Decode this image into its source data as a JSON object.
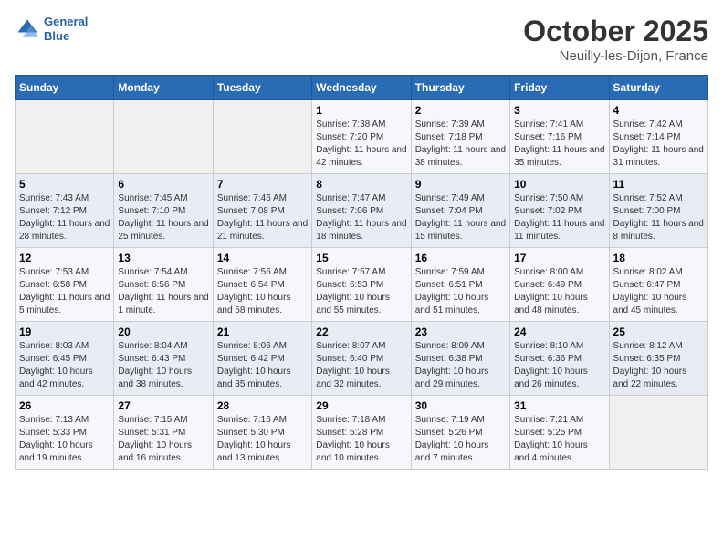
{
  "header": {
    "logo_line1": "General",
    "logo_line2": "Blue",
    "title": "October 2025",
    "subtitle": "Neuilly-les-Dijon, France"
  },
  "weekdays": [
    "Sunday",
    "Monday",
    "Tuesday",
    "Wednesday",
    "Thursday",
    "Friday",
    "Saturday"
  ],
  "weeks": [
    [
      {
        "day": "",
        "info": ""
      },
      {
        "day": "",
        "info": ""
      },
      {
        "day": "",
        "info": ""
      },
      {
        "day": "1",
        "info": "Sunrise: 7:38 AM\nSunset: 7:20 PM\nDaylight: 11 hours and 42 minutes."
      },
      {
        "day": "2",
        "info": "Sunrise: 7:39 AM\nSunset: 7:18 PM\nDaylight: 11 hours and 38 minutes."
      },
      {
        "day": "3",
        "info": "Sunrise: 7:41 AM\nSunset: 7:16 PM\nDaylight: 11 hours and 35 minutes."
      },
      {
        "day": "4",
        "info": "Sunrise: 7:42 AM\nSunset: 7:14 PM\nDaylight: 11 hours and 31 minutes."
      }
    ],
    [
      {
        "day": "5",
        "info": "Sunrise: 7:43 AM\nSunset: 7:12 PM\nDaylight: 11 hours and 28 minutes."
      },
      {
        "day": "6",
        "info": "Sunrise: 7:45 AM\nSunset: 7:10 PM\nDaylight: 11 hours and 25 minutes."
      },
      {
        "day": "7",
        "info": "Sunrise: 7:46 AM\nSunset: 7:08 PM\nDaylight: 11 hours and 21 minutes."
      },
      {
        "day": "8",
        "info": "Sunrise: 7:47 AM\nSunset: 7:06 PM\nDaylight: 11 hours and 18 minutes."
      },
      {
        "day": "9",
        "info": "Sunrise: 7:49 AM\nSunset: 7:04 PM\nDaylight: 11 hours and 15 minutes."
      },
      {
        "day": "10",
        "info": "Sunrise: 7:50 AM\nSunset: 7:02 PM\nDaylight: 11 hours and 11 minutes."
      },
      {
        "day": "11",
        "info": "Sunrise: 7:52 AM\nSunset: 7:00 PM\nDaylight: 11 hours and 8 minutes."
      }
    ],
    [
      {
        "day": "12",
        "info": "Sunrise: 7:53 AM\nSunset: 6:58 PM\nDaylight: 11 hours and 5 minutes."
      },
      {
        "day": "13",
        "info": "Sunrise: 7:54 AM\nSunset: 6:56 PM\nDaylight: 11 hours and 1 minute."
      },
      {
        "day": "14",
        "info": "Sunrise: 7:56 AM\nSunset: 6:54 PM\nDaylight: 10 hours and 58 minutes."
      },
      {
        "day": "15",
        "info": "Sunrise: 7:57 AM\nSunset: 6:53 PM\nDaylight: 10 hours and 55 minutes."
      },
      {
        "day": "16",
        "info": "Sunrise: 7:59 AM\nSunset: 6:51 PM\nDaylight: 10 hours and 51 minutes."
      },
      {
        "day": "17",
        "info": "Sunrise: 8:00 AM\nSunset: 6:49 PM\nDaylight: 10 hours and 48 minutes."
      },
      {
        "day": "18",
        "info": "Sunrise: 8:02 AM\nSunset: 6:47 PM\nDaylight: 10 hours and 45 minutes."
      }
    ],
    [
      {
        "day": "19",
        "info": "Sunrise: 8:03 AM\nSunset: 6:45 PM\nDaylight: 10 hours and 42 minutes."
      },
      {
        "day": "20",
        "info": "Sunrise: 8:04 AM\nSunset: 6:43 PM\nDaylight: 10 hours and 38 minutes."
      },
      {
        "day": "21",
        "info": "Sunrise: 8:06 AM\nSunset: 6:42 PM\nDaylight: 10 hours and 35 minutes."
      },
      {
        "day": "22",
        "info": "Sunrise: 8:07 AM\nSunset: 6:40 PM\nDaylight: 10 hours and 32 minutes."
      },
      {
        "day": "23",
        "info": "Sunrise: 8:09 AM\nSunset: 6:38 PM\nDaylight: 10 hours and 29 minutes."
      },
      {
        "day": "24",
        "info": "Sunrise: 8:10 AM\nSunset: 6:36 PM\nDaylight: 10 hours and 26 minutes."
      },
      {
        "day": "25",
        "info": "Sunrise: 8:12 AM\nSunset: 6:35 PM\nDaylight: 10 hours and 22 minutes."
      }
    ],
    [
      {
        "day": "26",
        "info": "Sunrise: 7:13 AM\nSunset: 5:33 PM\nDaylight: 10 hours and 19 minutes."
      },
      {
        "day": "27",
        "info": "Sunrise: 7:15 AM\nSunset: 5:31 PM\nDaylight: 10 hours and 16 minutes."
      },
      {
        "day": "28",
        "info": "Sunrise: 7:16 AM\nSunset: 5:30 PM\nDaylight: 10 hours and 13 minutes."
      },
      {
        "day": "29",
        "info": "Sunrise: 7:18 AM\nSunset: 5:28 PM\nDaylight: 10 hours and 10 minutes."
      },
      {
        "day": "30",
        "info": "Sunrise: 7:19 AM\nSunset: 5:26 PM\nDaylight: 10 hours and 7 minutes."
      },
      {
        "day": "31",
        "info": "Sunrise: 7:21 AM\nSunset: 5:25 PM\nDaylight: 10 hours and 4 minutes."
      },
      {
        "day": "",
        "info": ""
      }
    ]
  ]
}
